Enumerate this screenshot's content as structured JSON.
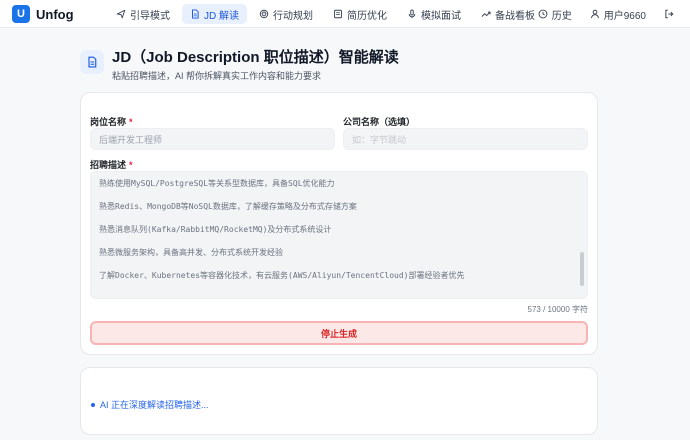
{
  "brand": {
    "name": "Unfog",
    "logo_letter": "U"
  },
  "nav": {
    "items": [
      {
        "label": "引导模式",
        "icon": "send-icon",
        "active": false
      },
      {
        "label": "JD 解读",
        "icon": "document-icon",
        "active": true
      },
      {
        "label": "行动规划",
        "icon": "target-icon",
        "active": false
      },
      {
        "label": "简历优化",
        "icon": "resume-icon",
        "active": false
      },
      {
        "label": "模拟面试",
        "icon": "microphone-icon",
        "active": false
      },
      {
        "label": "备战看板",
        "icon": "trend-icon",
        "active": false
      }
    ],
    "history_label": "历史",
    "user_label": "用户9660",
    "logout_icon": "logout-icon"
  },
  "header": {
    "title": "JD（Job Description 职位描述）智能解读",
    "subtitle": "粘贴招聘描述，AI 帮你拆解真实工作内容和能力要求"
  },
  "form": {
    "position_label": "岗位名称",
    "position_required": "*",
    "position_placeholder": "后端开发工程师",
    "company_label": "公司名称（选填）",
    "company_placeholder": "如：字节跳动",
    "jd_label": "招聘描述",
    "jd_required": "*",
    "jd_lines": [
      "熟练使用MySQL/PostgreSQL等关系型数据库，具备SQL优化能力",
      "熟悉Redis、MongoDB等NoSQL数据库，了解缓存策略及分布式存储方案",
      "熟悉消息队列(Kafka/RabbitMQ/RocketMQ)及分布式系统设计",
      "熟悉微服务架构，具备高并发、分布式系统开发经验",
      "了解Docker、Kubernetes等容器化技术，有云服务(AWS/Aliyun/TencentCloud)部署经验者优先"
    ],
    "char_count": "573 / 10000 字符",
    "stop_button": "停止生成"
  },
  "status": {
    "text": "AI 正在深度解读招聘描述..."
  },
  "colors": {
    "accent": "#1a73e8",
    "danger": "#dc2626",
    "danger_bg": "#fde8e8"
  }
}
